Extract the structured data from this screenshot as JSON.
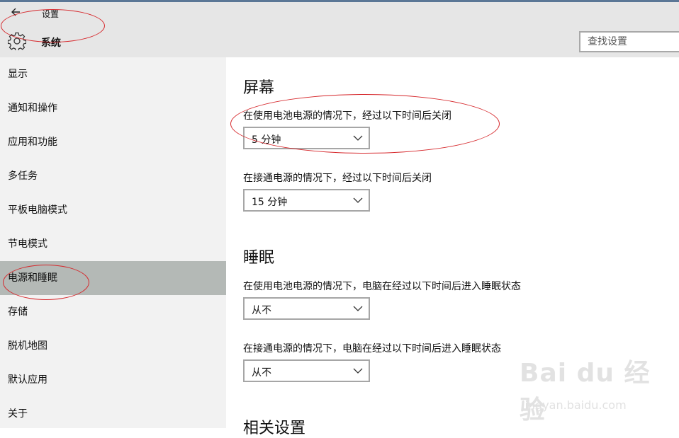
{
  "window": {
    "title": "设置",
    "back_icon": "arrow-left-icon"
  },
  "header": {
    "app_title": "系统",
    "app_icon": "gear-icon",
    "search_placeholder": "查找设置"
  },
  "sidebar": {
    "items": [
      {
        "label": "显示"
      },
      {
        "label": "通知和操作"
      },
      {
        "label": "应用和功能"
      },
      {
        "label": "多任务"
      },
      {
        "label": "平板电脑模式"
      },
      {
        "label": "节电模式"
      },
      {
        "label": "电源和睡眠",
        "selected": true
      },
      {
        "label": "存储"
      },
      {
        "label": "脱机地图"
      },
      {
        "label": "默认应用"
      },
      {
        "label": "关于"
      }
    ]
  },
  "main": {
    "screen": {
      "title": "屏幕",
      "battery_label": "在使用电池电源的情况下，经过以下时间后关闭",
      "battery_value": "5 分钟",
      "plugged_label": "在接通电源的情况下，经过以下时间后关闭",
      "plugged_value": "15 分钟"
    },
    "sleep": {
      "title": "睡眠",
      "battery_label": "在使用电池电源的情况下，电脑在经过以下时间后进入睡眠状态",
      "battery_value": "从不",
      "plugged_label": "在接通电源的情况下，电脑在经过以下时间后进入睡眠状态",
      "plugged_value": "从不"
    },
    "related": {
      "title": "相关设置"
    }
  },
  "watermark": {
    "logo": "Bai du 经验",
    "url": "jingyan.baidu.com"
  },
  "colors": {
    "header_bg": "#e6e6e6",
    "sidebar_bg": "#f2f2f2",
    "selected_bg": "#b4b9b6",
    "annotation_red": "#d6282c",
    "dropdown_border": "#a6a6a6"
  }
}
